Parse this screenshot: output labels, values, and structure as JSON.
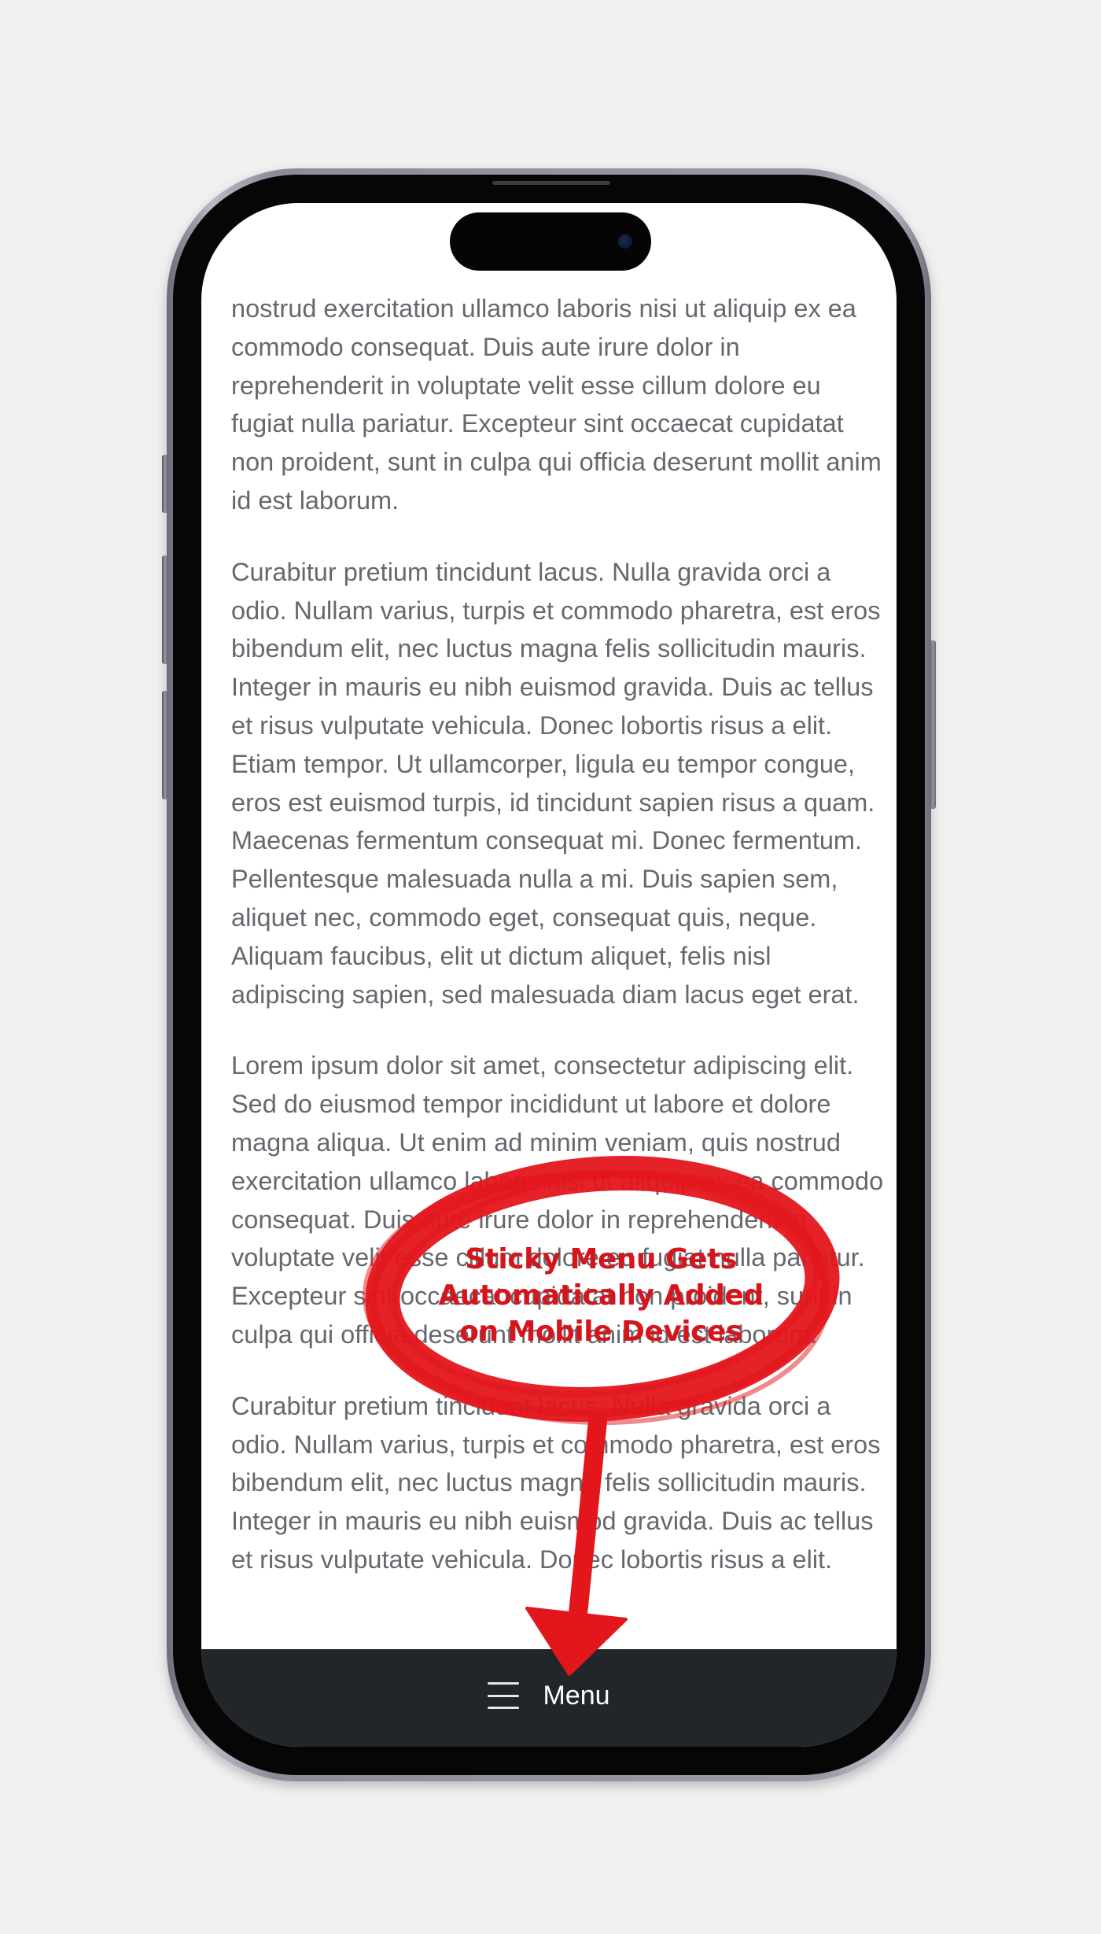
{
  "article": {
    "paragraphs": [
      "nostrud exercitation ullamco laboris nisi ut aliquip ex ea commodo consequat. Duis aute irure dolor in reprehenderit in voluptate velit esse cillum dolore eu fugiat nulla pariatur. Excepteur sint occaecat cupidatat non proident, sunt in culpa qui officia deserunt mollit anim id est laborum.",
      "Curabitur pretium tincidunt lacus. Nulla gravida orci a odio. Nullam varius, turpis et commodo pharetra, est eros bibendum elit, nec luctus magna felis sollicitudin mauris. Integer in mauris eu nibh euismod gravida. Duis ac tellus et risus vulputate vehicula. Donec lobortis risus a elit. Etiam tempor. Ut ullamcorper, ligula eu tempor congue, eros est euismod turpis, id tincidunt sapien risus a quam. Maecenas fermentum consequat mi. Donec fermentum. Pellentesque malesuada nulla a mi. Duis sapien sem, aliquet nec, commodo eget, consequat quis, neque. Aliquam faucibus, elit ut dictum aliquet, felis nisl adipiscing sapien, sed malesuada diam lacus eget erat.",
      "Lorem ipsum dolor sit amet, consectetur adipiscing elit. Sed do eiusmod tempor incididunt ut labore et dolore magna aliqua. Ut enim ad minim veniam, quis nostrud exercitation ullamco laboris nisi ut aliquip ex ea commodo consequat. Duis aute irure dolor in reprehenderit in voluptate velit esse cillum dolore eu fugiat nulla pariatur. Excepteur sint occaecat cupidatat non proident, sunt in culpa qui officia deserunt mollit anim id est laborum.",
      "Curabitur pretium tincidunt lacus. Nulla gravida orci a odio. Nullam varius, turpis et commodo pharetra, est eros bibendum elit, nec luctus magna felis sollicitudin mauris. Integer in mauris eu nibh euismod gravida. Duis ac tellus et risus vulputate vehicula. Donec lobortis risus a elit."
    ]
  },
  "menu_bar": {
    "icon": "hamburger-icon",
    "label": "Menu"
  },
  "annotation": {
    "text": "Sticky Menu Gets\nAutomatically Added\non Mobile Devices",
    "color": "#e3161c"
  },
  "colors": {
    "page_background": "#f0f0f0",
    "body_text": "#66686e",
    "menu_bar_background": "#222529",
    "menu_text": "#ffffff",
    "annotation_red": "#e3161c"
  }
}
